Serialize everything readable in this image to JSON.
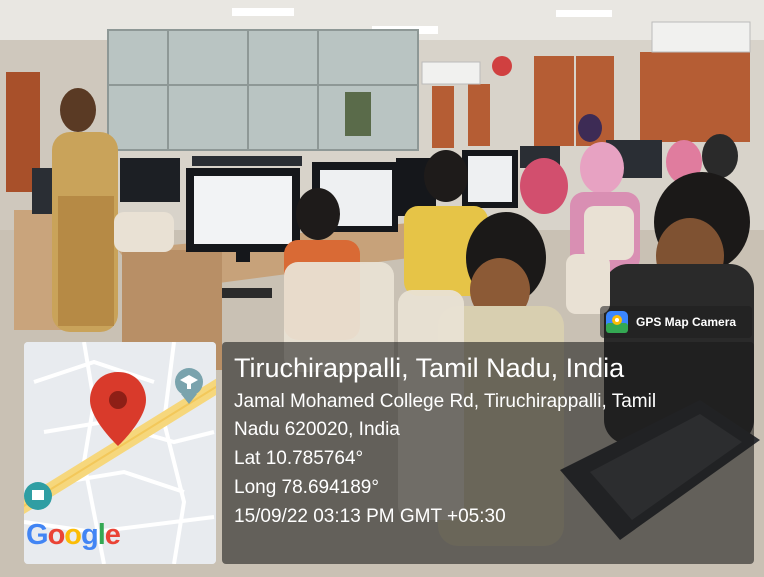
{
  "watermark": {
    "app_name": "GPS Map Camera",
    "app_icon": "gps-map-camera-icon",
    "map_logo": [
      "G",
      "o",
      "o",
      "g",
      "l",
      "e"
    ],
    "map_pin_icon": "map-pin-icon",
    "map_poi_icon": "school-poi-icon"
  },
  "location": {
    "title": "Tiruchirappalli, Tamil Nadu, India",
    "address_line_1": "Jamal Mohamed College Rd, Tiruchirappalli, Tamil",
    "address_line_2": "Nadu 620020, India",
    "latitude": "Lat 10.785764°",
    "longitude": "Long 78.694189°",
    "datetime": "15/09/22 03:13 PM GMT +05:30"
  },
  "colors": {
    "pin_red": "#D93A2B",
    "google_blue": "#4285F4",
    "google_red": "#EA4335",
    "google_yellow": "#FBBC05",
    "google_green": "#34A853"
  }
}
